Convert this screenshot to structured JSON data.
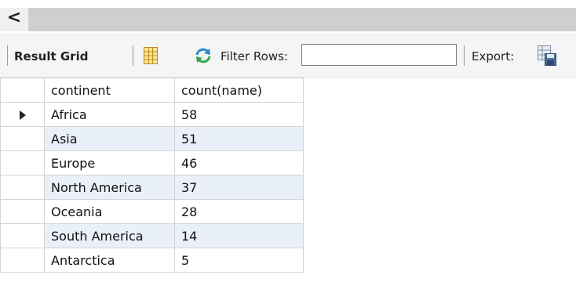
{
  "scrollbar": {
    "left_arrow": "<"
  },
  "toolbar": {
    "result_grid_label": "Result Grid",
    "filter_label": "Filter Rows:",
    "filter_value": "",
    "export_label": "Export:"
  },
  "table": {
    "columns": [
      "continent",
      "count(name)"
    ],
    "rows": [
      {
        "continent": "Africa",
        "count": "58"
      },
      {
        "continent": "Asia",
        "count": "51"
      },
      {
        "continent": "Europe",
        "count": "46"
      },
      {
        "continent": "North America",
        "count": "37"
      },
      {
        "continent": "Oceania",
        "count": "28"
      },
      {
        "continent": "South America",
        "count": "14"
      },
      {
        "continent": "Antarctica",
        "count": "5"
      }
    ],
    "current_row_indicator": "row-arrow"
  },
  "colors": {
    "alt_row": "#e9f0fa",
    "scroll_track": "#cfcfcf",
    "toolbar_bg": "#f5f5f5"
  }
}
